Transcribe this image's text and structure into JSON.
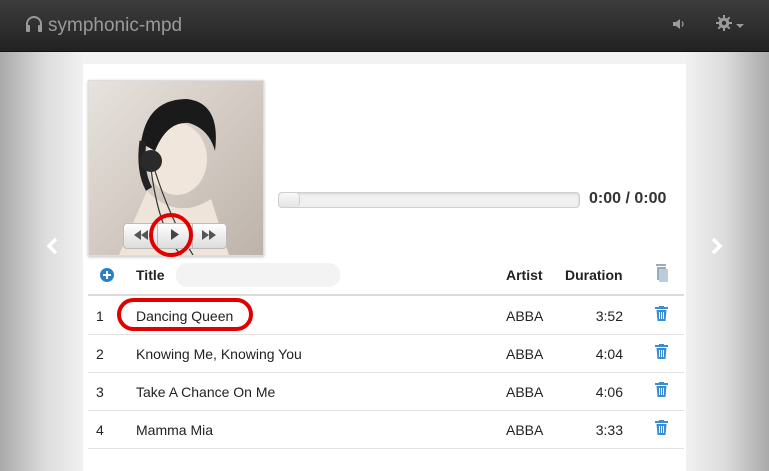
{
  "app": {
    "title": "symphonic-mpd",
    "icons": {
      "brand": "headphones-icon",
      "volume": "volume-icon",
      "settings": "gear-icon",
      "prev": "chevron-left-icon",
      "next": "chevron-right-icon"
    }
  },
  "player": {
    "controls": [
      "rewind-icon",
      "play-icon",
      "fast-forward-icon"
    ],
    "progress": 0,
    "time_display": "0:00 / 0:00"
  },
  "playlist": {
    "columns": {
      "title": "Title",
      "artist": "Artist",
      "duration": "Duration"
    },
    "rows": [
      {
        "num": "1",
        "title": "Dancing Queen",
        "artist": "ABBA",
        "duration": "3:52"
      },
      {
        "num": "2",
        "title": "Knowing Me, Knowing You",
        "artist": "ABBA",
        "duration": "4:04"
      },
      {
        "num": "3",
        "title": "Take A Chance On Me",
        "artist": "ABBA",
        "duration": "4:06"
      },
      {
        "num": "4",
        "title": "Mamma Mia",
        "artist": "ABBA",
        "duration": "3:33"
      }
    ]
  },
  "colors": {
    "accent": "#2a7fc9",
    "highlight": "#e00000",
    "navbar": "#2a2a2a"
  }
}
